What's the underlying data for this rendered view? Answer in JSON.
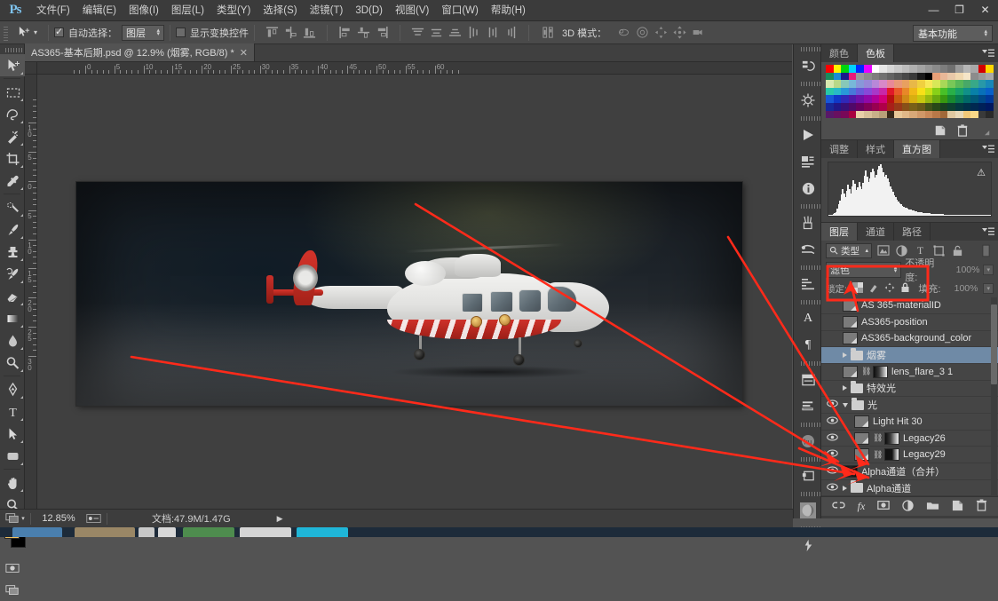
{
  "app": {
    "logo": "Ps",
    "title": "Adobe Photoshop"
  },
  "menu": {
    "items": [
      {
        "label": "文件(F)"
      },
      {
        "label": "编辑(E)"
      },
      {
        "label": "图像(I)"
      },
      {
        "label": "图层(L)"
      },
      {
        "label": "类型(Y)"
      },
      {
        "label": "选择(S)"
      },
      {
        "label": "滤镜(T)"
      },
      {
        "label": "3D(D)"
      },
      {
        "label": "视图(V)"
      },
      {
        "label": "窗口(W)"
      },
      {
        "label": "帮助(H)"
      }
    ]
  },
  "window_controls": {
    "minimize": "—",
    "restore": "❐",
    "close": "✕"
  },
  "options_bar": {
    "tool_icon": "move-tool-icon",
    "auto_select_label": "自动选择：",
    "auto_select_checked": true,
    "auto_select_value": "图层",
    "show_transform_label": "显示变换控件",
    "show_transform_checked": false,
    "mode_3d_label": "3D 模式：",
    "workspace": "基本功能"
  },
  "document_tab": {
    "title": "AS365-基本后期.psd @ 12.9% (烟雾, RGB/8) *",
    "close": "✕"
  },
  "rulers": {
    "horizontal_ticks": [
      "0",
      "5",
      "10",
      "15",
      "20",
      "25",
      "30",
      "35",
      "40",
      "45",
      "50",
      "55",
      "60"
    ],
    "vertical_ticks": [
      "10",
      "5",
      "0",
      "5",
      "10",
      "15",
      "20",
      "25"
    ],
    "unit": "cm"
  },
  "toolbar": {
    "tools": [
      {
        "name": "move-tool",
        "glyph": "move",
        "active": true
      },
      {
        "name": "marquee-tool",
        "glyph": "marquee",
        "active": false
      },
      {
        "name": "lasso-tool",
        "glyph": "lasso",
        "active": false
      },
      {
        "name": "quick-selection-tool",
        "glyph": "wand",
        "active": false
      },
      {
        "name": "crop-tool",
        "glyph": "crop",
        "active": false
      },
      {
        "name": "eyedropper-tool",
        "glyph": "eyedropper",
        "active": false
      },
      {
        "name": "spot-healing-tool",
        "glyph": "heal",
        "active": false
      },
      {
        "name": "brush-tool",
        "glyph": "brush",
        "active": false
      },
      {
        "name": "clone-stamp-tool",
        "glyph": "stamp",
        "active": false
      },
      {
        "name": "history-brush-tool",
        "glyph": "historybrush",
        "active": false
      },
      {
        "name": "eraser-tool",
        "glyph": "eraser",
        "active": false
      },
      {
        "name": "gradient-tool",
        "glyph": "gradient",
        "active": false
      },
      {
        "name": "blur-tool",
        "glyph": "blur",
        "active": false
      },
      {
        "name": "dodge-tool",
        "glyph": "dodge",
        "active": false
      },
      {
        "name": "pen-tool",
        "glyph": "pen",
        "active": false
      },
      {
        "name": "type-tool",
        "glyph": "type",
        "active": false
      },
      {
        "name": "path-selection-tool",
        "glyph": "pathselect",
        "active": false
      },
      {
        "name": "rectangle-tool",
        "glyph": "rect",
        "active": false
      },
      {
        "name": "hand-tool",
        "glyph": "hand",
        "active": false
      },
      {
        "name": "zoom-tool",
        "glyph": "zoom",
        "active": false
      }
    ],
    "foreground_color": "#f0c060",
    "background_color": "#000000"
  },
  "dock": {
    "buttons": [
      {
        "name": "history-panel-icon",
        "glyph": "history"
      },
      {
        "name": "actions-panel-icon",
        "glyph": "actions"
      },
      {
        "name": "timeline-play-icon",
        "glyph": "play"
      },
      {
        "name": "properties-panel-icon",
        "glyph": "properties"
      },
      {
        "name": "info-panel-icon",
        "glyph": "info"
      },
      {
        "name": "brush-presets-icon",
        "glyph": "brushpreset"
      },
      {
        "name": "tool-presets-icon",
        "glyph": "toolpreset"
      },
      {
        "name": "paragraph-styles-icon",
        "glyph": "parastyle"
      },
      {
        "name": "character-panel-icon",
        "glyph": "character"
      },
      {
        "name": "paragraph-panel-icon",
        "glyph": "paragraph"
      },
      {
        "name": "notes-panel-icon",
        "glyph": "notes"
      },
      {
        "name": "measurement-log-icon",
        "glyph": "measure"
      },
      {
        "name": "kuler-panel-icon",
        "glyph": "kuler"
      },
      {
        "name": "clone-source-icon",
        "glyph": "clonesource"
      },
      {
        "name": "3d-panel-icon",
        "glyph": "panel3d"
      },
      {
        "name": "animation-panel-icon",
        "glyph": "animation"
      }
    ]
  },
  "color_panel": {
    "tabs": [
      {
        "label": "颜色",
        "active": false
      },
      {
        "label": "色板",
        "active": true
      }
    ],
    "footer_buttons": [
      {
        "name": "new-swatch-button",
        "glyph": "newpage"
      },
      {
        "name": "delete-swatch-button",
        "glyph": "trash"
      }
    ],
    "swatch_rows": [
      [
        "#fe0000",
        "#fff200",
        "#00d40b",
        "#00d2ff",
        "#0028ff",
        "#e800ff",
        "#ffffff",
        "#e6e6e6",
        "#d6d6d6",
        "#c9c9c9",
        "#bdbdbd",
        "#b0b0b0",
        "#a3a3a3",
        "#969696",
        "#8a8a8a",
        "#7d7d7d",
        "#707070",
        "#9a9a9a",
        "#b5b5b5",
        "#a8a8a8",
        "#d40000",
        "#ffd700"
      ],
      [
        "#1a8c5c",
        "#1a8cd4",
        "#1a1a8c",
        "#e81a7c",
        "#9a9a9a",
        "#8c8c8c",
        "#7e7e7e",
        "#717171",
        "#636363",
        "#565656",
        "#484848",
        "#3a3a3a",
        "#1a1a1a",
        "#000000",
        "#e8a078",
        "#e8b898",
        "#e8c8a8",
        "#f0d8b0",
        "#f5e5c8",
        "#8c8c8c",
        "#9a9a9a",
        "#a8a8a8"
      ],
      [
        "#d8e8b0",
        "#b8d888",
        "#88c8b8",
        "#78b8d8",
        "#8898d8",
        "#9888d8",
        "#b888d8",
        "#d888c8",
        "#e88898",
        "#e89878",
        "#e8a060",
        "#e8b848",
        "#f0d040",
        "#f8e858",
        "#d8e858",
        "#a8d858",
        "#78c858",
        "#58b858",
        "#48a868",
        "#38a888",
        "#2898a8",
        "#1888b8"
      ],
      [
        "#28c8a8",
        "#28b8c8",
        "#2898d8",
        "#4878d8",
        "#6858d8",
        "#8848d8",
        "#a838c8",
        "#c828a8",
        "#e01828",
        "#e85828",
        "#e88828",
        "#f0b818",
        "#f8e018",
        "#c8e018",
        "#88d018",
        "#48c028",
        "#28b048",
        "#18a068",
        "#109088",
        "#0880a8",
        "#0870b8",
        "#0860c8"
      ],
      [
        "#1858d8",
        "#1038c8",
        "#3028b8",
        "#5018a8",
        "#7010a8",
        "#9008a8",
        "#b00098",
        "#d00078",
        "#b81010",
        "#c85810",
        "#d08818",
        "#d8b010",
        "#c8c810",
        "#98b810",
        "#68a810",
        "#389810",
        "#188830",
        "#087850",
        "#006868",
        "#005878",
        "#004888",
        "#003898"
      ],
      [
        "#182898",
        "#201888",
        "#381078",
        "#500868",
        "#680060",
        "#800058",
        "#980050",
        "#b00048",
        "#a82018",
        "#983818",
        "#885018",
        "#786018",
        "#685818",
        "#405018",
        "#284818",
        "#184020",
        "#0c4030",
        "#043840",
        "#003048",
        "#002850",
        "#002058",
        "#001860"
      ],
      [
        "#581868",
        "#681060",
        "#780858",
        "#a80040",
        "#e8d0a8",
        "#d8c098",
        "#c8b088",
        "#b8a078",
        "#382818",
        "#e8c898",
        "#e0b888",
        "#d8a878",
        "#d09868",
        "#c88858",
        "#b87848",
        "#a06838",
        "#e0c8a0",
        "#e8d8b8",
        "#f0c878",
        "#f8d888",
        "#3a3a3a",
        "#2a2a2a"
      ]
    ]
  },
  "histogram_panel": {
    "tabs": [
      {
        "label": "调整",
        "active": false
      },
      {
        "label": "样式",
        "active": false
      },
      {
        "label": "直方图",
        "active": true
      }
    ],
    "warning_icon": "⚠",
    "values": [
      1,
      1,
      2,
      3,
      5,
      8,
      14,
      22,
      30,
      42,
      52,
      44,
      36,
      48,
      60,
      52,
      44,
      58,
      70,
      62,
      50,
      56,
      66,
      58,
      52,
      64,
      78,
      88,
      76,
      66,
      72,
      84,
      92,
      86,
      74,
      80,
      90,
      96,
      100,
      94,
      84,
      76,
      80,
      72,
      66,
      58,
      52,
      46,
      40,
      36,
      32,
      28,
      25,
      22,
      20,
      18,
      16,
      15,
      14,
      13,
      12,
      11,
      10,
      9,
      9,
      8,
      8,
      7,
      7,
      6,
      6,
      6,
      5,
      5,
      5,
      4,
      4,
      4,
      4,
      3,
      3,
      3,
      3,
      3,
      3,
      2,
      2,
      2,
      2,
      2,
      2,
      2,
      2,
      2,
      2,
      2,
      2,
      2,
      2,
      2,
      2,
      2,
      2,
      2,
      2,
      2,
      2,
      2,
      2,
      2,
      2,
      2,
      2,
      2,
      1,
      1,
      1,
      1,
      1,
      1
    ]
  },
  "layers_panel": {
    "tabs": [
      {
        "label": "图层",
        "active": true
      },
      {
        "label": "通道",
        "active": false
      },
      {
        "label": "路径",
        "active": false
      }
    ],
    "filter": {
      "kind_label": "类型",
      "kind_icon": "filter-search-icon",
      "type_buttons": [
        {
          "name": "filter-pixel-layers-icon",
          "glyph": "pixel"
        },
        {
          "name": "filter-adjustment-layers-icon",
          "glyph": "adjust"
        },
        {
          "name": "filter-type-layers-icon",
          "glyph": "T"
        },
        {
          "name": "filter-shape-layers-icon",
          "glyph": "shape"
        },
        {
          "name": "filter-smart-object-icon",
          "glyph": "smart"
        }
      ],
      "toggle": "filter-enable-toggle"
    },
    "blend_mode": "滤色",
    "opacity_label": "不透明度:",
    "opacity_value": "100%",
    "lock_label": "锁定:",
    "fill_label": "填充:",
    "fill_value": "100%",
    "lock_buttons": [
      {
        "name": "lock-transparent-pixels-icon",
        "glyph": "checker"
      },
      {
        "name": "lock-image-pixels-icon",
        "glyph": "brush"
      },
      {
        "name": "lock-position-icon",
        "glyph": "move"
      },
      {
        "name": "lock-all-icon",
        "glyph": "lock"
      }
    ],
    "layers": [
      {
        "name": "AS 365-materialID",
        "visible": false,
        "type": "smart",
        "selected": false,
        "indent": 0,
        "thumb": "smart"
      },
      {
        "name": "AS365-position",
        "visible": false,
        "type": "smart",
        "selected": false,
        "indent": 0,
        "thumb": "smart"
      },
      {
        "name": "AS365-background_color",
        "visible": false,
        "type": "smart",
        "selected": false,
        "indent": 0,
        "thumb": "smart"
      },
      {
        "name": "烟雾",
        "visible": false,
        "type": "group",
        "selected": true,
        "indent": 0,
        "expanded": false
      },
      {
        "name": "lens_flare_3 1",
        "visible": false,
        "type": "smart-mask",
        "selected": false,
        "indent": 0,
        "thumb": "grad"
      },
      {
        "name": "特效光",
        "visible": false,
        "type": "group",
        "selected": false,
        "indent": 0,
        "expanded": false
      },
      {
        "name": "光",
        "visible": true,
        "type": "group",
        "selected": false,
        "indent": 0,
        "expanded": true
      },
      {
        "name": "Light Hit 30",
        "visible": true,
        "type": "smart",
        "selected": false,
        "indent": 1,
        "thumb": "smart"
      },
      {
        "name": "Legacy26",
        "visible": true,
        "type": "smart-mask",
        "selected": false,
        "indent": 1,
        "thumb": "grad"
      },
      {
        "name": "Legacy29",
        "visible": true,
        "type": "smart-mask",
        "selected": false,
        "indent": 1,
        "thumb": "grad2"
      },
      {
        "name": "Alpha通道（合并）",
        "visible": true,
        "type": "pixel",
        "selected": false,
        "indent": 0,
        "thumb": "alpha"
      },
      {
        "name": "Alpha通道",
        "visible": true,
        "type": "group",
        "selected": false,
        "indent": 0,
        "expanded": false
      }
    ],
    "footer_buttons": [
      {
        "name": "link-layers-button",
        "glyph": "link"
      },
      {
        "name": "layer-style-button",
        "glyph": "fx"
      },
      {
        "name": "add-layer-mask-button",
        "glyph": "mask"
      },
      {
        "name": "new-adjustment-layer-button",
        "glyph": "adjust"
      },
      {
        "name": "new-group-button",
        "glyph": "folder"
      },
      {
        "name": "new-layer-button",
        "glyph": "newlayer"
      },
      {
        "name": "delete-layer-button",
        "glyph": "trash"
      }
    ]
  },
  "status_bar": {
    "zoom": "12.85%",
    "doc_info": "文档:47.9M/1.47G",
    "expand_arrow": "▶"
  },
  "annotations": {
    "highlight_color": "#ff2a1a",
    "highlight_box_label": "blend-mode-highlight-box",
    "arrows": [
      {
        "name": "arrow-to-blend-mode"
      },
      {
        "name": "arrow-to-legacy26"
      },
      {
        "name": "arrow-to-legacy29"
      },
      {
        "name": "arrow-to-light-group"
      }
    ]
  },
  "canvas": {
    "image_description": "AS365 Dauphin helicopter render",
    "artboard_bg": "#1e2227"
  }
}
